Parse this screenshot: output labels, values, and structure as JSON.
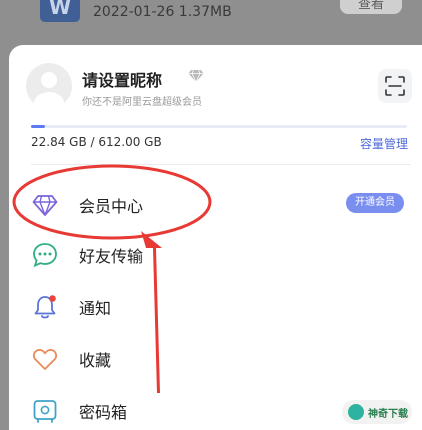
{
  "background_file": {
    "meta": "2022-01-26 1.37MB",
    "view_button": "查看",
    "icon_letter": "W",
    "icon": "word-doc-icon"
  },
  "profile": {
    "nickname": "请设置昵称",
    "subtitle": "你还不是阿里云盘超级会员",
    "badge_icon": "diamond-badge-icon",
    "scan_icon": "scan-icon"
  },
  "storage": {
    "usage_text": "22.84 GB / 612.00 GB",
    "used_fraction": 0.0373,
    "manage_label": "容量管理"
  },
  "menu": {
    "items": [
      {
        "label": "会员中心",
        "icon": "diamond-icon",
        "badge": "开通会员"
      },
      {
        "label": "好友传输",
        "icon": "chat-bubble-icon"
      },
      {
        "label": "通知",
        "icon": "bell-icon"
      },
      {
        "label": "收藏",
        "icon": "heart-icon"
      },
      {
        "label": "密码箱",
        "icon": "safe-box-icon"
      }
    ]
  },
  "annotation": {
    "shape": "red-ellipse-with-arrow",
    "color": "#e83a35"
  },
  "watermark": {
    "text": "神奇下载",
    "icon": "watermark-logo-icon"
  },
  "colors": {
    "accent": "#5b7cf5",
    "vip_pill": "#7a8ef0",
    "annotation_red": "#e83a35"
  }
}
